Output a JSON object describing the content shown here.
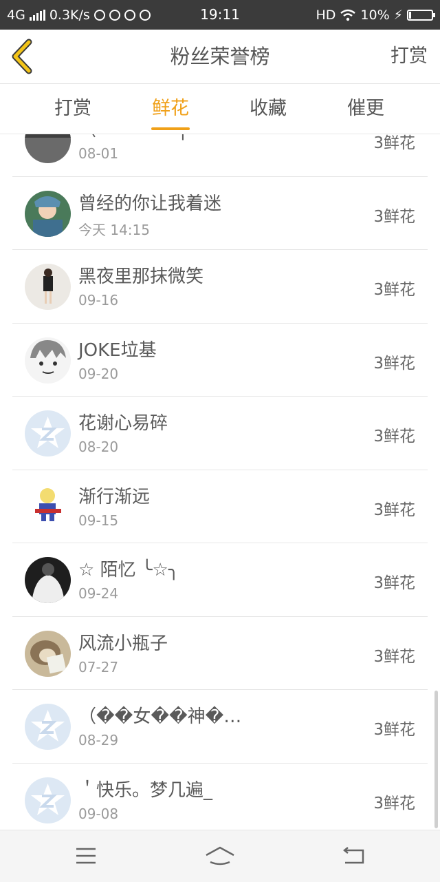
{
  "status_bar": {
    "network": "4G",
    "speed": "0.3K/s",
    "time": "19:11",
    "hd": "HD",
    "battery": "10%",
    "battery_level": 0.1
  },
  "header": {
    "title": "粉丝荣誉榜",
    "right_action": "打赏"
  },
  "tabs": [
    {
      "label": "打赏",
      "active": false
    },
    {
      "label": "鲜花",
      "active": true
    },
    {
      "label": "收藏",
      "active": false
    },
    {
      "label": "催更",
      "active": false
    }
  ],
  "rows": [
    {
      "name": "〈 ‒ ⁘ ‒ ∽ ╮ ∽",
      "date": "08-01",
      "count": "3鲜花",
      "avatar": "photo-dark"
    },
    {
      "name": "曾经的你让我着迷",
      "date": "今天 14:15",
      "count": "3鲜花",
      "avatar": "photo-girl"
    },
    {
      "name": "黑夜里那抹微笑",
      "date": "09-16",
      "count": "3鲜花",
      "avatar": "photo-figure"
    },
    {
      "name": "JOKE垃基",
      "date": "09-20",
      "count": "3鲜花",
      "avatar": "sketch-face"
    },
    {
      "name": "花谢心易碎",
      "date": "08-20",
      "count": "3鲜花",
      "avatar": "qzone-default"
    },
    {
      "name": "渐行渐远",
      "date": "09-15",
      "count": "3鲜花",
      "avatar": "cartoon-boy"
    },
    {
      "name": "☆ 陌忆 ╰☆╮",
      "date": "09-24",
      "count": "3鲜花",
      "avatar": "photo-bw"
    },
    {
      "name": "风流小瓶子",
      "date": "07-27",
      "count": "3鲜花",
      "avatar": "photo-hedgehog"
    },
    {
      "name": "（��女��神�…",
      "date": "08-29",
      "count": "3鲜花",
      "avatar": "qzone-default"
    },
    {
      "name": "＇快乐。梦几遍_",
      "date": "09-08",
      "count": "3鲜花",
      "avatar": "qzone-default"
    }
  ],
  "navbar": {
    "items": [
      "menu-icon",
      "home-icon",
      "back-icon"
    ]
  },
  "colors": {
    "accent": "#f0a018",
    "status_bar_bg": "#3b3b3b",
    "avatar_default_bg": "#dde8f4"
  }
}
